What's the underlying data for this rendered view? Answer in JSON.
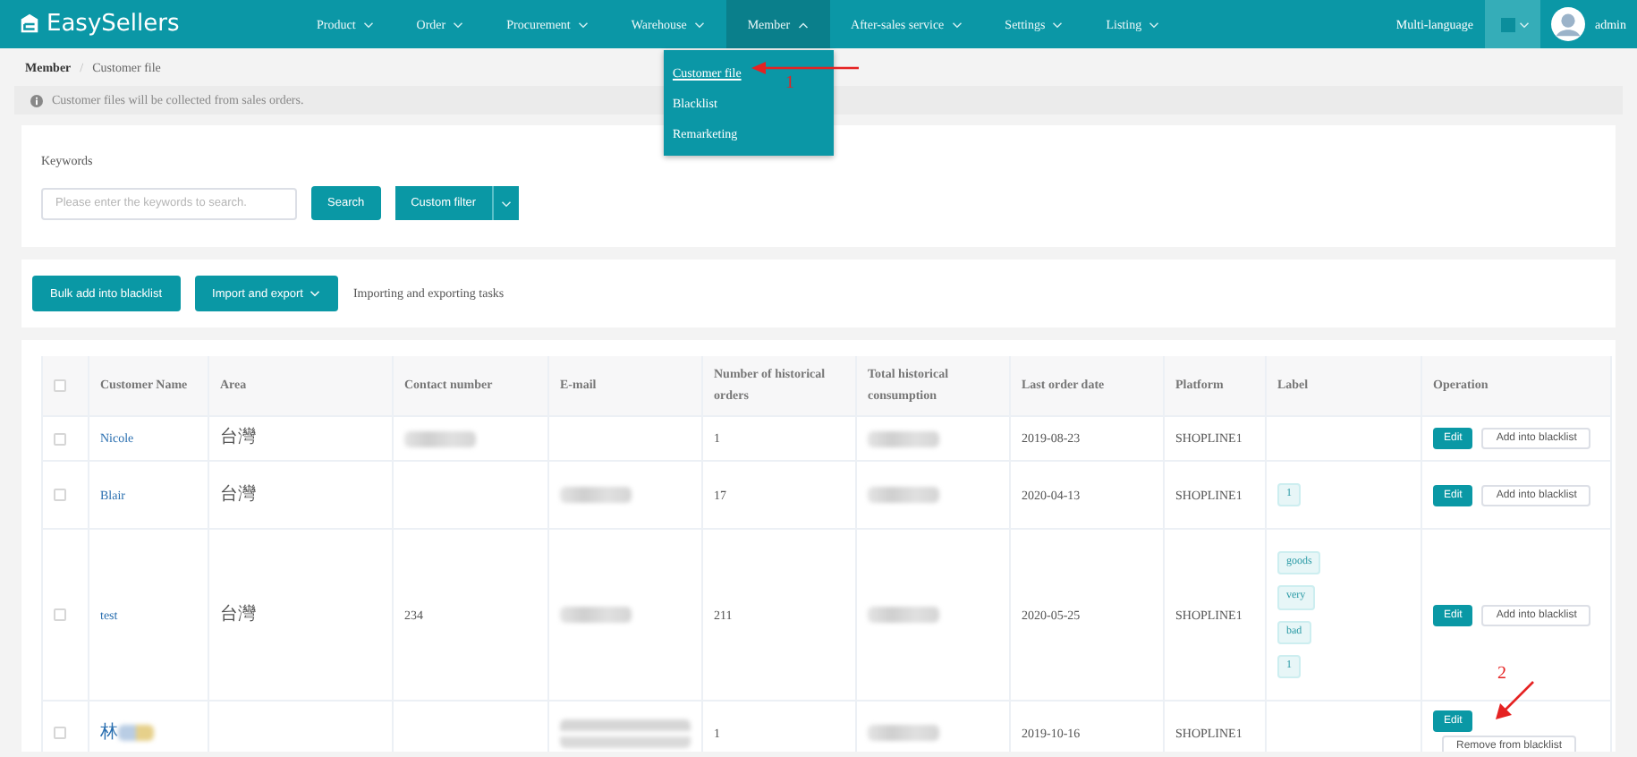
{
  "app": {
    "logo": "EasySellers"
  },
  "nav": [
    {
      "label": "Product",
      "expanded": false
    },
    {
      "label": "Order",
      "expanded": false
    },
    {
      "label": "Procurement",
      "expanded": false
    },
    {
      "label": "Warehouse",
      "expanded": false
    },
    {
      "label": "Member",
      "expanded": true
    },
    {
      "label": "After-sales service",
      "expanded": false
    },
    {
      "label": "Settings",
      "expanded": false
    },
    {
      "label": "Listing",
      "expanded": false
    }
  ],
  "header_right": {
    "language": "Multi-language",
    "user": "admin"
  },
  "menu": [
    {
      "label": "Customer file",
      "selected": true
    },
    {
      "label": "Blacklist",
      "selected": false
    },
    {
      "label": "Remarketing",
      "selected": false
    }
  ],
  "breadcrumb": [
    "Member",
    "/",
    "Customer file"
  ],
  "notice": "Customer files will be collected from sales orders.",
  "filter": {
    "label": "Keywords",
    "placeholder": "Please enter the keywords to search.",
    "search": "Search",
    "custom": "Custom filter"
  },
  "actions": {
    "bulk": "Bulk add into blacklist",
    "import": "Import and export",
    "tasks": "Importing and exporting tasks"
  },
  "table": {
    "select_all_checked": false,
    "columns": [
      "Customer Name",
      "Area",
      "Contact number",
      "E-mail",
      "Number of historical orders",
      "Total historical consumption",
      "Last order date",
      "Platform",
      "Label",
      "Operation"
    ],
    "rows": [
      {
        "checked": false,
        "cells": [
          {
            "kind": "link",
            "text": "Nicole"
          },
          {
            "kind": "text",
            "text": "台灣"
          },
          {
            "kind": "blurred"
          },
          {
            "kind": "empty"
          },
          {
            "kind": "text",
            "text": "1"
          },
          {
            "kind": "blurred"
          },
          {
            "kind": "text",
            "text": "2019-08-23"
          },
          {
            "kind": "text",
            "text": "SHOPLINE1"
          }
        ],
        "labels": [],
        "buttons": [
          {
            "kind": "primary",
            "label": "Edit"
          },
          {
            "kind": "plain",
            "label": "Add into blacklist"
          }
        ]
      },
      {
        "checked": false,
        "cells": [
          {
            "kind": "link",
            "text": "Blair"
          },
          {
            "kind": "text",
            "text": "台灣"
          },
          {
            "kind": "empty"
          },
          {
            "kind": "blurred"
          },
          {
            "kind": "text",
            "text": "17"
          },
          {
            "kind": "blurred"
          },
          {
            "kind": "text",
            "text": "2020-04-13"
          },
          {
            "kind": "text",
            "text": "SHOPLINE1"
          }
        ],
        "labels": [
          "1"
        ],
        "buttons": [
          {
            "kind": "primary",
            "label": "Edit"
          },
          {
            "kind": "plain",
            "label": "Add into blacklist"
          }
        ]
      },
      {
        "checked": false,
        "cells": [
          {
            "kind": "link",
            "text": "test"
          },
          {
            "kind": "text",
            "text": "台灣"
          },
          {
            "kind": "text",
            "text": "234"
          },
          {
            "kind": "blurred"
          },
          {
            "kind": "text",
            "text": "211"
          },
          {
            "kind": "blurred"
          },
          {
            "kind": "text",
            "text": "2020-05-25"
          },
          {
            "kind": "text",
            "text": "SHOPLINE1"
          }
        ],
        "labels": [
          "goods",
          "very",
          "bad",
          "1"
        ],
        "buttons": [
          {
            "kind": "primary",
            "label": "Edit"
          },
          {
            "kind": "plain",
            "label": "Add into blacklist"
          }
        ]
      },
      {
        "checked": false,
        "cells": [
          {
            "kind": "link-blurred",
            "text": "林"
          },
          {
            "kind": "empty"
          },
          {
            "kind": "empty"
          },
          {
            "kind": "blurred-tall"
          },
          {
            "kind": "text",
            "text": "1"
          },
          {
            "kind": "blurred"
          },
          {
            "kind": "text",
            "text": "2019-10-16"
          },
          {
            "kind": "text",
            "text": "SHOPLINE1"
          }
        ],
        "labels": [],
        "buttons": [
          {
            "kind": "primary",
            "label": "Edit"
          },
          {
            "kind": "plain",
            "label": "Remove from blacklist"
          }
        ]
      }
    ]
  },
  "annotations": [
    {
      "label": "1"
    },
    {
      "label": "2"
    }
  ]
}
